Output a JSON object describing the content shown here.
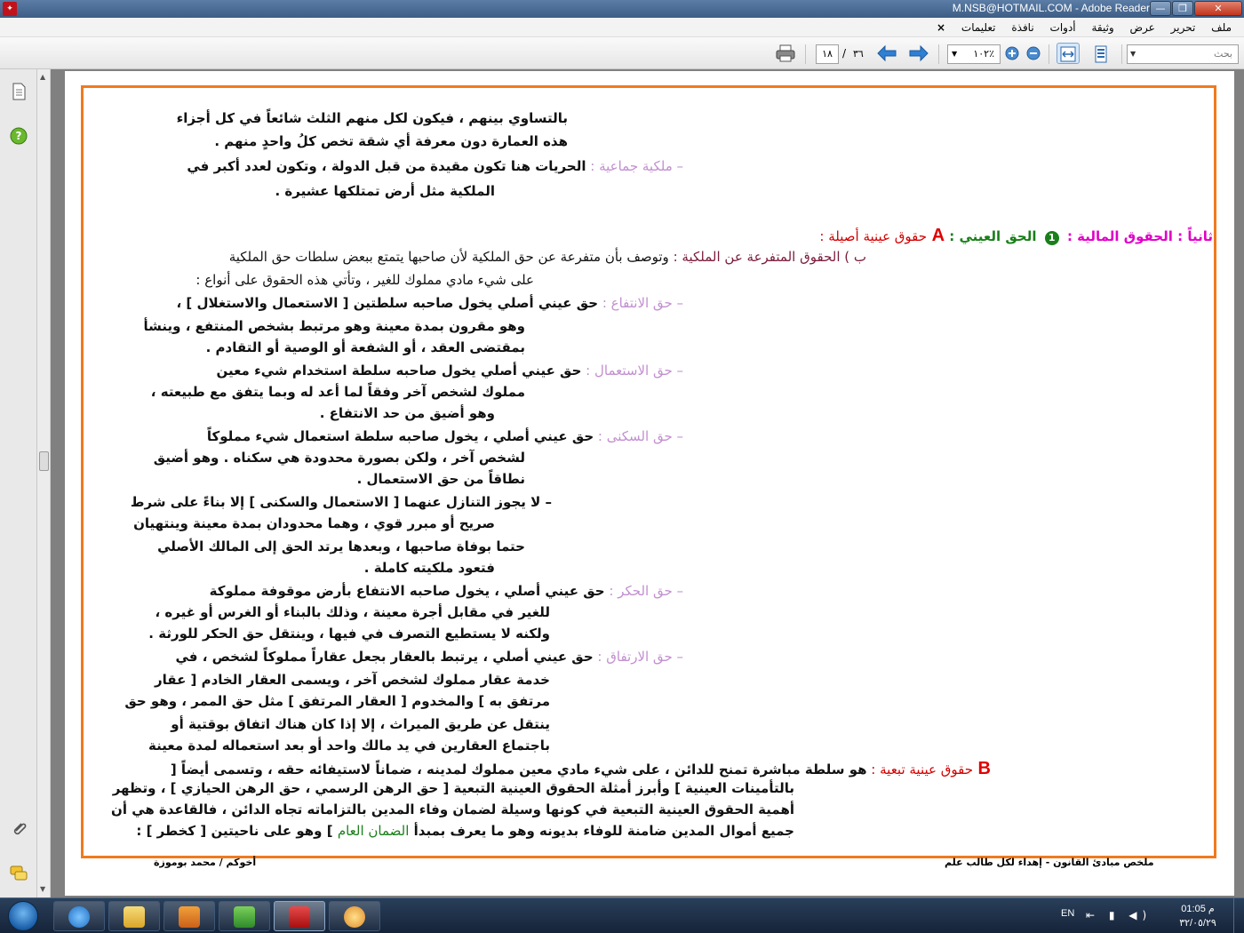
{
  "window": {
    "title": "M.NSB@HOTMAIL.COM - Adobe Reader",
    "min_glyph": "—",
    "max_glyph": "❐",
    "close_glyph": "✕"
  },
  "menu": {
    "items": [
      "ملف",
      "تحرير",
      "عرض",
      "وثيقة",
      "أدوات",
      "نافذة",
      "تعليمات"
    ],
    "close_glyph": "×"
  },
  "toolbar": {
    "search_placeholder": "بحث",
    "zoom": "١٠٢٪",
    "page_current": "١٨",
    "page_sep": "/",
    "page_total": "٣٦"
  },
  "document": {
    "lines": [
      {
        "segs": [
          {
            "t": "بالتساوي بينهم ، فيكون لكل منهم الثلث شائعاً في كل أجزاء",
            "c": "b"
          }
        ]
      },
      {
        "segs": [
          {
            "t": "هذه العمارة دون معرفة أي شقة تخص كلُ واحدٍ منهم .",
            "c": "b"
          }
        ]
      },
      {
        "segs": [
          {
            "t": "–  ملكية جماعية : ",
            "c": "lav"
          },
          {
            "t": "الحريات هنا تكون مقيدة من قبل الدولة ، وتكون لعدد أكبر في",
            "c": "b"
          }
        ]
      },
      {
        "segs": [
          {
            "t": "الملكية مثل أرض تمتلكها عشيرة .",
            "c": "b"
          }
        ]
      },
      {
        "segs": [
          {
            "t": "ثانياً : الحقوق المالية : ",
            "c": "mag"
          },
          {
            "t": "1",
            "c": "num"
          },
          {
            "t": " الحق العيني : ",
            "c": "grn"
          },
          {
            "t": "A ",
            "c": "bigA"
          },
          {
            "t": "حقوق عينية أصيلة :",
            "c": "red"
          }
        ]
      },
      {
        "segs": [
          {
            "t": "ب ) الحقوق المتفرعة عن الملكية : ",
            "c": "maroon"
          },
          {
            "t": "وتوصف بأن متفرعة عن حق الملكية لأن صاحبها يتمتع ببعض سلطات حق الملكية",
            "c": ""
          }
        ]
      },
      {
        "segs": [
          {
            "t": "على شيء مادي مملوك للغير ، وتأتي هذه الحقوق على أنواع :",
            "c": ""
          }
        ]
      },
      {
        "segs": [
          {
            "t": "–  حق الانتفاع : ",
            "c": "lav"
          },
          {
            "t": "حق عيني أصلي يخول صاحبه سلطتين [ الاستعمال والاستغلال ] ،",
            "c": "b"
          }
        ]
      },
      {
        "segs": [
          {
            "t": "وهو مقرون بمدة معينة وهو مرتبط بشخص المنتفع ، وينشأ",
            "c": "b"
          }
        ]
      },
      {
        "segs": [
          {
            "t": "بمقتضى العقد ، أو الشفعة أو الوصية أو التقادم .",
            "c": "b"
          }
        ]
      },
      {
        "segs": [
          {
            "t": "–  حق الاستعمال : ",
            "c": "lav"
          },
          {
            "t": "حق عيني أصلي يخول صاحبه سلطة استخدام شيء معين",
            "c": "b"
          }
        ]
      },
      {
        "segs": [
          {
            "t": "مملوك لشخص آخر وفقاً لما أعد له وبما يتفق مع طبيعته ،",
            "c": "b"
          }
        ]
      },
      {
        "segs": [
          {
            "t": "وهو أضيق من حد الانتفاع .",
            "c": "b"
          }
        ]
      },
      {
        "segs": [
          {
            "t": "–  حق السكنى : ",
            "c": "lav"
          },
          {
            "t": "حق عيني أصلي ، يخول صاحبه سلطة استعمال شيء مملوكاً",
            "c": "b"
          }
        ]
      },
      {
        "segs": [
          {
            "t": "لشخص آخر ، ولكن بصورة محدودة هي سكناه . وهو أضيق",
            "c": "b"
          }
        ]
      },
      {
        "segs": [
          {
            "t": "نطاقاً من حق الاستعمال .",
            "c": "b"
          }
        ]
      },
      {
        "segs": [
          {
            "t": "–   لا يجوز التنازل عنهما [ الاستعمال والسكنى ] إلا بناءً على شرط",
            "c": "b"
          }
        ]
      },
      {
        "segs": [
          {
            "t": "صريح أو مبرر قوي ، وهما محدودان بمدة معينة وينتهيان",
            "c": "b"
          }
        ]
      },
      {
        "segs": [
          {
            "t": "حتما بوفاة صاحبها ، وبعدها يرتد الحق إلى المالك الأصلي",
            "c": "b"
          }
        ]
      },
      {
        "segs": [
          {
            "t": "فتعود ملكيته كاملة .",
            "c": "b"
          }
        ]
      },
      {
        "segs": [
          {
            "t": "–  حق الحكر : ",
            "c": "lav"
          },
          {
            "t": "حق عيني أصلي ، يخول صاحبه الانتفاع بأرض موقوفة مملوكة",
            "c": "b"
          }
        ]
      },
      {
        "segs": [
          {
            "t": "للغير في مقابل أجرة معينة ، وذلك بالبناء أو الغرس أو غيره ،",
            "c": "b"
          }
        ]
      },
      {
        "segs": [
          {
            "t": "ولكنه لا يستطيع التصرف في فيها ، وينتقل حق الحكر للورثة .",
            "c": "b"
          }
        ]
      },
      {
        "segs": [
          {
            "t": "–  حق الارتفاق : ",
            "c": "lav"
          },
          {
            "t": "حق عيني أصلي ، يرتبط بالعقار بجعل عقاراً مملوكاً لشخص ، في",
            "c": "b"
          }
        ]
      },
      {
        "segs": [
          {
            "t": "خدمة عقار مملوك لشخص آخر ، ويسمى العقار الخادم [ عقار",
            "c": "b"
          }
        ]
      },
      {
        "segs": [
          {
            "t": "مرتفق به ] والمخدوم [ العقار المرتفق ] مثل حق الممر ، وهو حق",
            "c": "b"
          }
        ]
      },
      {
        "segs": [
          {
            "t": "ينتقل عن طريق الميراث ، إلا إذا كان هناك اتفاق بوقتية أو",
            "c": "b"
          }
        ]
      },
      {
        "segs": [
          {
            "t": "باجتماع العقارين في يد مالك واحد أو بعد استعماله لمدة معينة",
            "c": "b"
          }
        ]
      },
      {
        "segs": [
          {
            "t": "B ",
            "c": "bigA"
          },
          {
            "t": "حقوق عينية تبعية : ",
            "c": "red"
          },
          {
            "t": "هو سلطة مباشرة تمنح للدائن ، على شيء مادي معين مملوك لمدينه ، ضماناً لاستيفائه حقه ، وتسمى أيضاً [",
            "c": "b"
          }
        ]
      },
      {
        "segs": [
          {
            "t": "بالتأمينات العينية ] وأبرز أمثلة الحقوق العينية التبعية [ حق الرهن الرسمي ، حق الرهن الحيازي ] ، وتظهر",
            "c": "b"
          }
        ]
      },
      {
        "segs": [
          {
            "t": "أهمية الحقوق العينية التبعية في كونها وسيلة لضمان وفاء المدين بالتزاماته تجاه الدائن ، فالقاعدة هي أن",
            "c": "b"
          }
        ]
      },
      {
        "segs": [
          {
            "t": "جميع أموال المدين ضامنة للوفاء بديونه وهو ما يعرف بمبدأ ",
            "c": "b"
          },
          {
            "t": "الضمان العام",
            "c": "grn2"
          },
          {
            "t": " ] وهو على ناحيتين [ كخطر ] :",
            "c": "b"
          }
        ]
      }
    ],
    "footer_right": "ملخص مبادئ القانون -  إهداء لكل طالب علم",
    "footer_left": "أخوكم / محمد بوموزة"
  },
  "taskbar": {
    "lang": "EN",
    "tray_icons": "⇤ ▮ ◀)",
    "time": "01:05 م",
    "date": "٣٢/٠٥/٢٩"
  },
  "colors": {
    "frame": "#f07a1e",
    "heading_magenta": "#e000c8",
    "lavender": "#c28fd0",
    "red": "#d20000",
    "green": "#1a7f1a"
  }
}
